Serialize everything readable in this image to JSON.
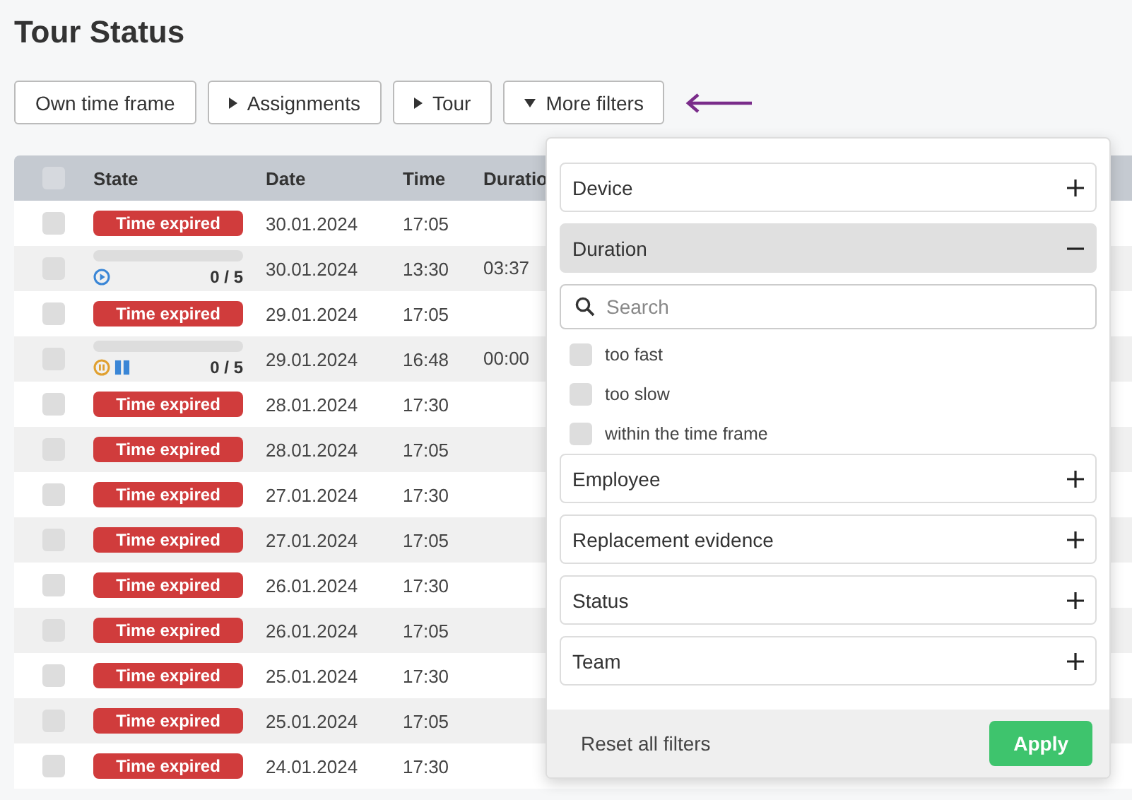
{
  "title": "Tour Status",
  "filter_buttons": [
    {
      "label": "Own time frame",
      "kind": "plain"
    },
    {
      "label": "Assignments",
      "kind": "collapsed"
    },
    {
      "label": "Tour",
      "kind": "collapsed"
    },
    {
      "label": "More filters",
      "kind": "expanded"
    }
  ],
  "table": {
    "columns": [
      "State",
      "Date",
      "Time",
      "Duratio"
    ],
    "all_checked": false,
    "rows": [
      {
        "kind": "expired",
        "checked": false,
        "badge": "Time expired",
        "date": "30.01.2024",
        "time": "17:05"
      },
      {
        "kind": "running",
        "checked": false,
        "level": 0,
        "count": "0 / 5",
        "date": "30.01.2024",
        "time": "13:30",
        "duration": "03:37"
      },
      {
        "kind": "expired",
        "checked": false,
        "badge": "Time expired",
        "date": "29.01.2024",
        "time": "17:05"
      },
      {
        "kind": "paused",
        "checked": false,
        "level": 0,
        "count": "0 / 5",
        "date": "29.01.2024",
        "time": "16:48",
        "duration": "00:00"
      },
      {
        "kind": "expired",
        "checked": false,
        "badge": "Time expired",
        "date": "28.01.2024",
        "time": "17:30"
      },
      {
        "kind": "expired",
        "checked": false,
        "badge": "Time expired",
        "date": "28.01.2024",
        "time": "17:05"
      },
      {
        "kind": "expired",
        "checked": false,
        "badge": "Time expired",
        "date": "27.01.2024",
        "time": "17:30"
      },
      {
        "kind": "expired",
        "checked": false,
        "badge": "Time expired",
        "date": "27.01.2024",
        "time": "17:05"
      },
      {
        "kind": "expired",
        "checked": false,
        "badge": "Time expired",
        "date": "26.01.2024",
        "time": "17:30"
      },
      {
        "kind": "expired",
        "checked": false,
        "badge": "Time expired",
        "date": "26.01.2024",
        "time": "17:05"
      },
      {
        "kind": "expired",
        "checked": false,
        "badge": "Time expired",
        "date": "25.01.2024",
        "time": "17:30"
      },
      {
        "kind": "expired",
        "checked": false,
        "badge": "Time expired",
        "date": "25.01.2024",
        "time": "17:05"
      },
      {
        "kind": "expired",
        "checked": false,
        "badge": "Time expired",
        "date": "24.01.2024",
        "time": "17:30"
      }
    ]
  },
  "filter_panel": {
    "sections": [
      {
        "label": "Device",
        "expanded": false
      },
      {
        "label": "Duration",
        "expanded": true,
        "search": {
          "placeholder": "Search"
        },
        "options": [
          {
            "label": "too fast",
            "checked": false
          },
          {
            "label": "too slow",
            "checked": false
          },
          {
            "label": "within the time frame",
            "checked": false
          }
        ]
      },
      {
        "label": "Employee",
        "expanded": false
      },
      {
        "label": "Replacement evidence",
        "expanded": false
      },
      {
        "label": "Status",
        "expanded": false
      },
      {
        "label": "Team",
        "expanded": false
      }
    ],
    "reset": "Reset all filters",
    "apply": "Apply"
  }
}
